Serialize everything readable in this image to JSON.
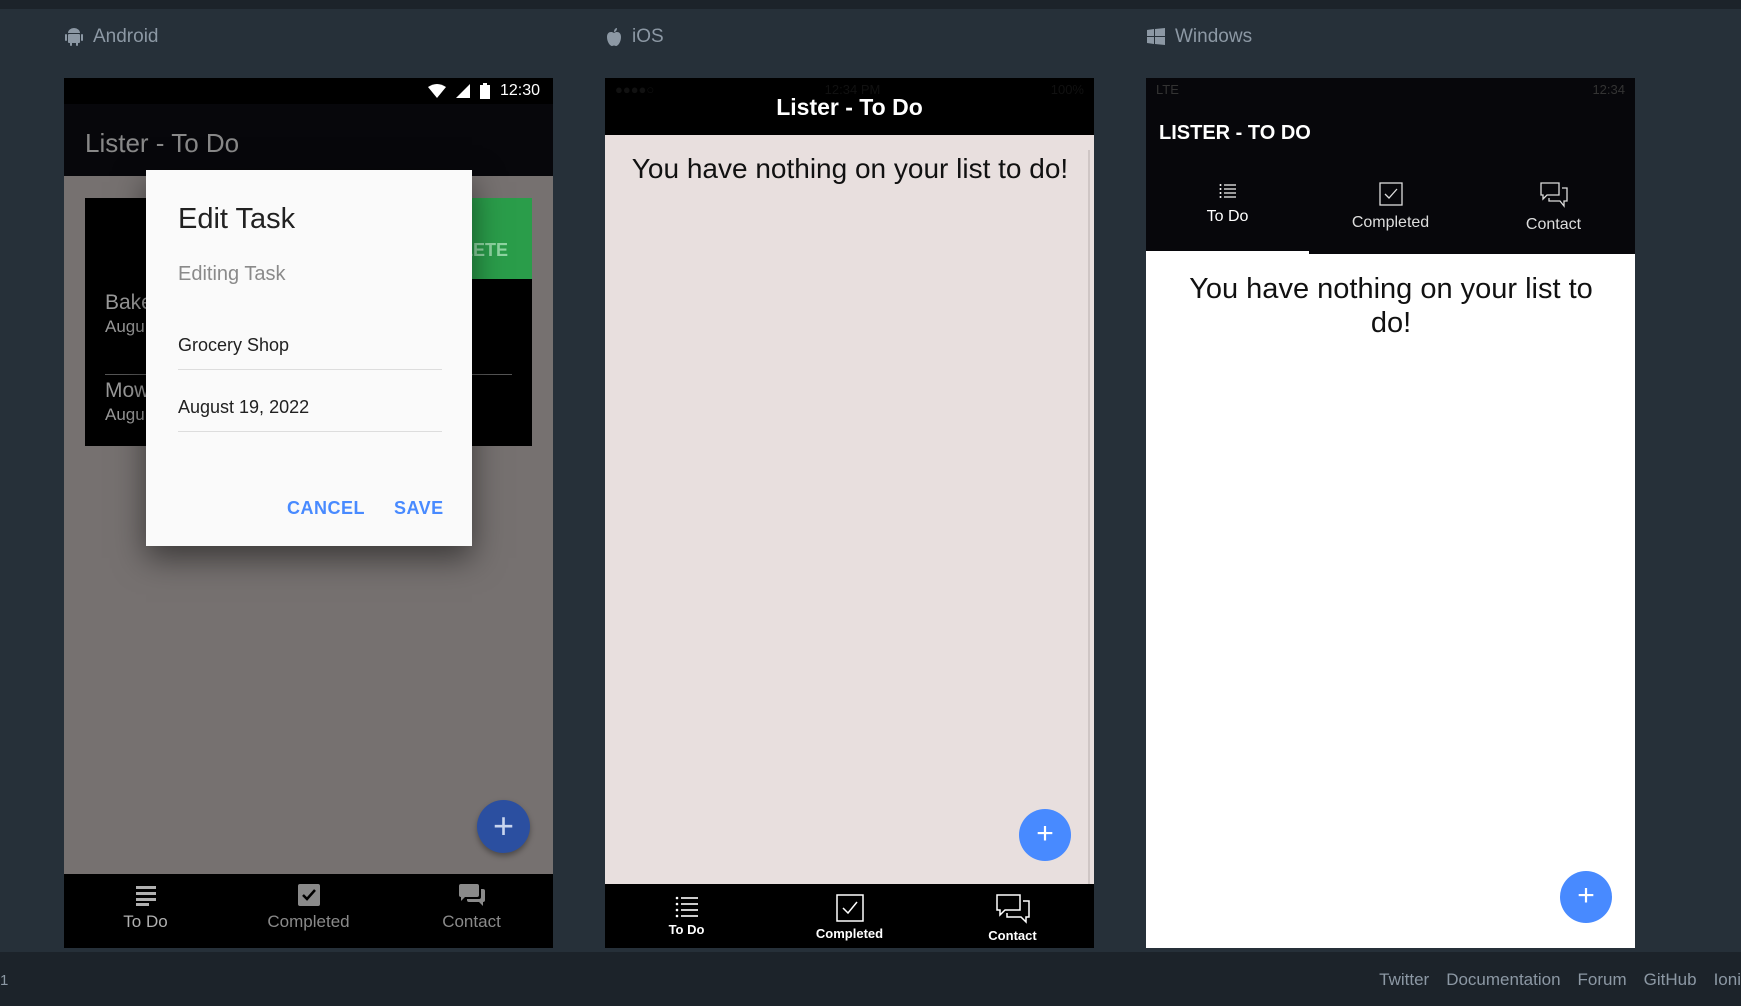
{
  "platforms": {
    "android": {
      "label": "Android",
      "status_time": "12:30",
      "toolbar_title": "Lister - To Do",
      "card": {
        "complete_label": "PLETE",
        "items": [
          {
            "title": "Bake",
            "subtitle": "Augu"
          },
          {
            "title": "Mow",
            "subtitle": "Augu"
          }
        ]
      },
      "dialog": {
        "title": "Edit Task",
        "subtitle": "Editing Task",
        "task_value": "Grocery Shop",
        "date_value": "August 19, 2022",
        "cancel_label": "CANCEL",
        "save_label": "SAVE"
      },
      "fab_glyph": "+",
      "tabs": [
        {
          "label": "To Do",
          "icon": "list-icon"
        },
        {
          "label": "Completed",
          "icon": "checkbox-icon"
        },
        {
          "label": "Contact",
          "icon": "chat-icon"
        }
      ]
    },
    "ios": {
      "label": "iOS",
      "status_left": "●●●●○",
      "status_time": "12:34 PM",
      "status_battery": "100%",
      "title": "Lister - To Do",
      "empty_message": "You have nothing on your list to do!",
      "fab_glyph": "+",
      "tabs": [
        {
          "label": "To Do",
          "icon": "list-icon"
        },
        {
          "label": "Completed",
          "icon": "checkbox-icon"
        },
        {
          "label": "Contact",
          "icon": "chat-icon"
        }
      ]
    },
    "windows": {
      "label": "Windows",
      "status_network": "LTE",
      "status_time": "12:34",
      "title": "LISTER - TO DO",
      "empty_message": "You have nothing on your list to do!",
      "fab_glyph": "+",
      "tabs": [
        {
          "label": "To Do",
          "icon": "list-icon"
        },
        {
          "label": "Completed",
          "icon": "checkbox-icon"
        },
        {
          "label": "Contact",
          "icon": "chat-icon"
        }
      ]
    }
  },
  "footer": {
    "left_text": "1",
    "links": [
      "Twitter",
      "Documentation",
      "Forum",
      "GitHub",
      "Ioni"
    ]
  },
  "colors": {
    "page_bg": "#263039",
    "accent": "#488aff",
    "complete_green": "#2a9d4a"
  }
}
